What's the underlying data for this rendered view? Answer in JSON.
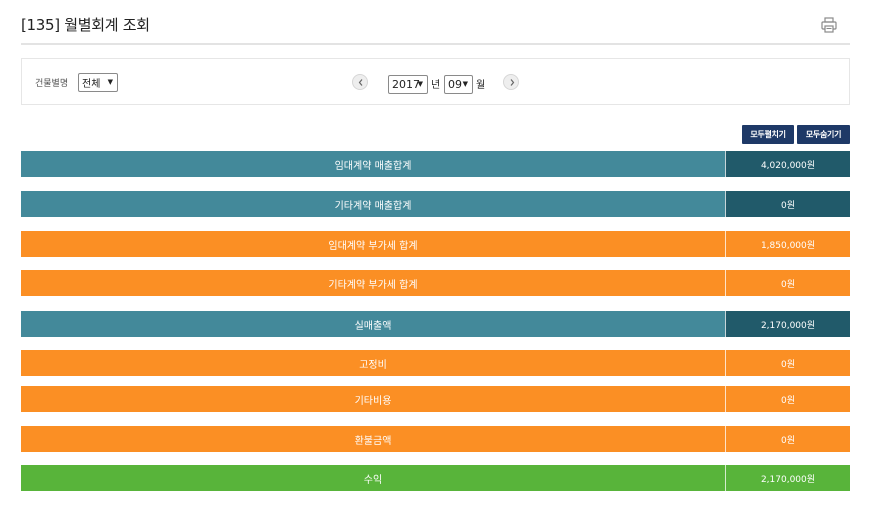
{
  "header": {
    "title": "[135] 월별회계 조회",
    "print_icon": "printer-icon"
  },
  "filters": {
    "building_label": "건물별명",
    "building_value": "전체",
    "year_value": "2017",
    "year_unit": "년",
    "month_value": "09",
    "month_unit": "월",
    "prev_icon": "chevron-left-icon",
    "next_icon": "chevron-right-icon"
  },
  "actions": {
    "expand_all": "모두펼치기",
    "collapse_all": "모두숨기기"
  },
  "colors": {
    "teal": "#43899a",
    "teal_dark": "#215a6a",
    "orange": "#fb8f24",
    "green": "#58b43a",
    "navy_button": "#1e3967"
  },
  "rows": [
    {
      "label": "임대계약 매출합계",
      "value": "4,020,000원",
      "label_color": "#43899a",
      "value_color": "#215a6a"
    },
    {
      "label": "기타계약 매출합계",
      "value": "0원",
      "label_color": "#43899a",
      "value_color": "#215a6a"
    },
    {
      "label": "임대계약 부가세 합계",
      "value": "1,850,000원",
      "label_color": "#fb8f24",
      "value_color": "#fb8f24"
    },
    {
      "label": "기타계약 부가세 합계",
      "value": "0원",
      "label_color": "#fb8f24",
      "value_color": "#fb8f24"
    },
    {
      "label": "실매출액",
      "value": "2,170,000원",
      "label_color": "#43899a",
      "value_color": "#215a6a"
    },
    {
      "label": "고정비",
      "value": "0원",
      "label_color": "#fb8f24",
      "value_color": "#fb8f24"
    },
    {
      "label": "기타비용",
      "value": "0원",
      "label_color": "#fb8f24",
      "value_color": "#fb8f24"
    },
    {
      "label": "환불금액",
      "value": "0원",
      "label_color": "#fb8f24",
      "value_color": "#fb8f24"
    },
    {
      "label": "수익",
      "value": "2,170,000원",
      "label_color": "#58b43a",
      "value_color": "#58b43a"
    }
  ]
}
